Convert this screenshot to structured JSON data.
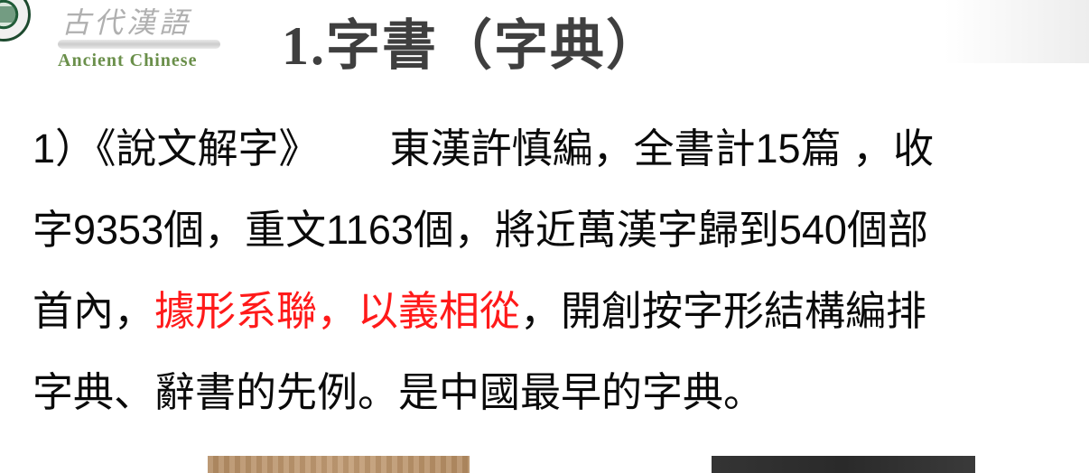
{
  "header": {
    "brand_cn": "古代漢語",
    "brand_en": "Ancient   Chinese",
    "title": "1.字書（字典）"
  },
  "content": {
    "line1_lead": "1）《說文解字》",
    "line1_rest": "東漢許慎編，全書計15篇 ，收",
    "line2": "字9353個，重文1163個，將近萬漢字歸到540個部",
    "line3_a": "首內，",
    "line3_highlight": "據形系聯，以義相從",
    "line3_b": "，開創按字形結構編排",
    "line4": "字典、辭書的先例。是中國最早的字典。"
  },
  "colors": {
    "highlight": "#ff1a1a",
    "text": "#0a0a0a",
    "title": "#3f3f3f",
    "brand_en": "#6a8f4a"
  }
}
